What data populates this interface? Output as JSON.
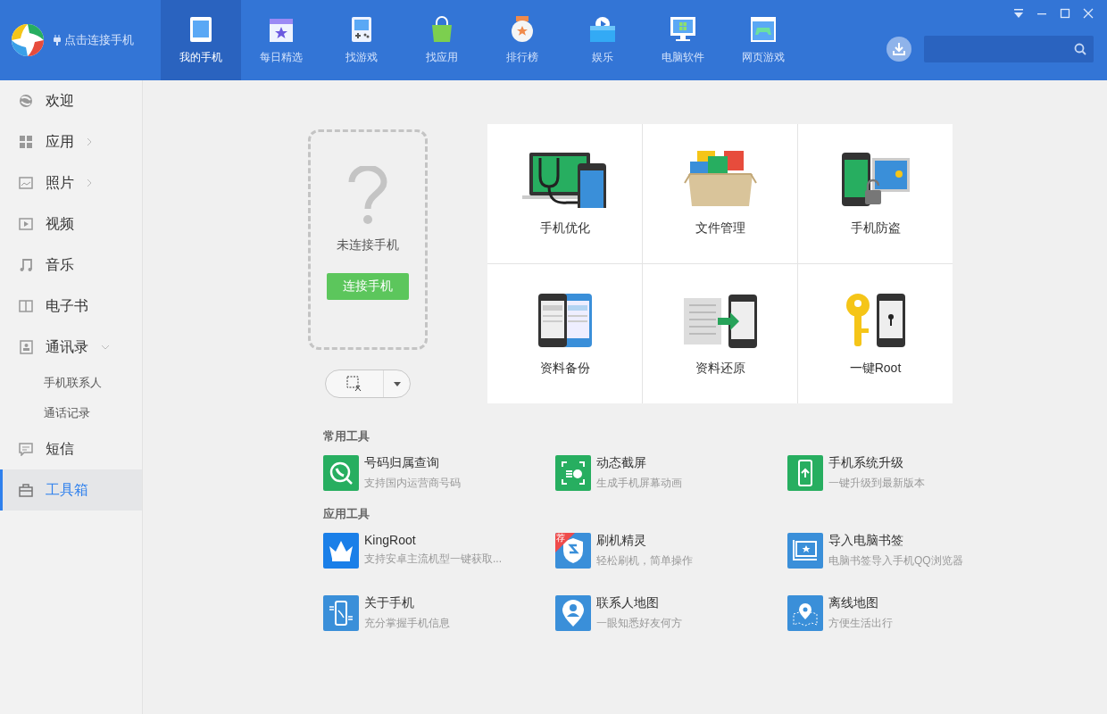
{
  "header": {
    "connect_label": "点击连接手机"
  },
  "nav_tabs": [
    {
      "label": "我的手机",
      "selected": true
    },
    {
      "label": "每日精选",
      "selected": false
    },
    {
      "label": "找游戏",
      "selected": false
    },
    {
      "label": "找应用",
      "selected": false
    },
    {
      "label": "排行榜",
      "selected": false
    },
    {
      "label": "娱乐",
      "selected": false
    },
    {
      "label": "电脑软件",
      "selected": false
    },
    {
      "label": "网页游戏",
      "selected": false
    }
  ],
  "sidebar": {
    "items": [
      {
        "label": "欢迎",
        "selected": false
      },
      {
        "label": "应用",
        "selected": false,
        "expanded": false
      },
      {
        "label": "照片",
        "selected": false,
        "expanded": false
      },
      {
        "label": "视频",
        "selected": false
      },
      {
        "label": "音乐",
        "selected": false
      },
      {
        "label": "电子书",
        "selected": false
      },
      {
        "label": "通讯录",
        "selected": false,
        "expanded": true,
        "children": [
          {
            "label": "手机联系人"
          },
          {
            "label": "通话记录"
          }
        ]
      },
      {
        "label": "短信",
        "selected": false
      },
      {
        "label": "工具箱",
        "selected": true
      }
    ]
  },
  "phone_card": {
    "status": "未连接手机",
    "button": "连接手机"
  },
  "feature_grid": [
    {
      "label": "手机优化"
    },
    {
      "label": "文件管理"
    },
    {
      "label": "手机防盗"
    },
    {
      "label": "资料备份"
    },
    {
      "label": "资料还原"
    },
    {
      "label": "一键Root"
    }
  ],
  "tool_sections": [
    {
      "title": "常用工具",
      "tools": [
        {
          "name": "号码归属查询",
          "desc": "支持国内运营商号码",
          "color": "#27ae60"
        },
        {
          "name": "动态截屏",
          "desc": "生成手机屏幕动画",
          "color": "#27ae60"
        },
        {
          "name": "手机系统升级",
          "desc": "一键升级到最新版本",
          "color": "#27ae60"
        }
      ]
    },
    {
      "title": "应用工具",
      "tools": [
        {
          "name": "KingRoot",
          "desc": "支持安卓主流机型一键获取...",
          "color": "#1a7fe8"
        },
        {
          "name": "刷机精灵",
          "desc": "轻松刷机，简单操作",
          "color": "#3a8fd9",
          "badge": "荐"
        },
        {
          "name": "导入电脑书签",
          "desc": "电脑书签导入手机QQ浏览器",
          "color": "#3a8fd9"
        },
        {
          "name": "关于手机",
          "desc": "充分掌握手机信息",
          "color": "#3a8fd9"
        },
        {
          "name": "联系人地图",
          "desc": "一眼知悉好友何方",
          "color": "#3a8fd9"
        },
        {
          "name": "离线地图",
          "desc": "方便生活出行",
          "color": "#3a8fd9"
        }
      ]
    }
  ]
}
